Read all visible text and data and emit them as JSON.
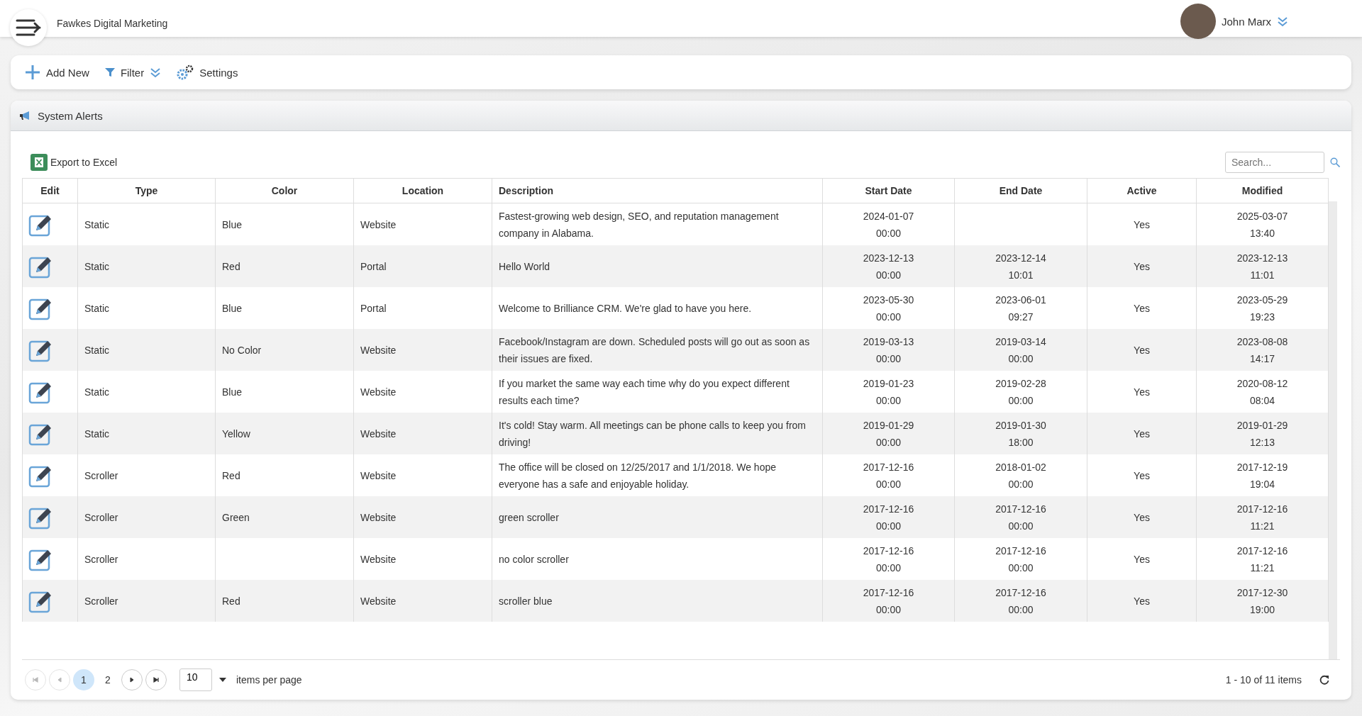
{
  "header": {
    "company": "Fawkes Digital Marketing",
    "user": "John Marx"
  },
  "toolbar": [
    {
      "kind": "add",
      "label": "Add New"
    },
    {
      "kind": "filter",
      "label": "Filter"
    },
    {
      "kind": "settings",
      "label": "Settings"
    }
  ],
  "panel": {
    "title": "System Alerts",
    "export_label": "Export to Excel",
    "search": {
      "placeholder": "Search..."
    }
  },
  "table": {
    "columns": [
      "Edit",
      "Type",
      "Color",
      "Location",
      "Description",
      "Start Date",
      "End Date",
      "Active",
      "Modified"
    ],
    "rows": [
      {
        "type": "Static",
        "color_name": "Blue",
        "location": "Website",
        "description": "Fastest-growing web design, SEO, and reputation management company in Alabama.",
        "start": [
          "2024-01-07",
          "00:00"
        ],
        "end": [],
        "active": "Yes",
        "modified": [
          "2025-03-07",
          "13:40"
        ]
      },
      {
        "type": "Static",
        "color_name": "Red",
        "location": "Portal",
        "description": "Hello World",
        "start": [
          "2023-12-13",
          "00:00"
        ],
        "end": [
          "2023-12-14",
          "10:01"
        ],
        "active": "Yes",
        "modified": [
          "2023-12-13",
          "11:01"
        ]
      },
      {
        "type": "Static",
        "color_name": "Blue",
        "location": "Portal",
        "description": "Welcome to Brilliance CRM. We're glad to have you here.",
        "start": [
          "2023-05-30",
          "00:00"
        ],
        "end": [
          "2023-06-01",
          "09:27"
        ],
        "active": "Yes",
        "modified": [
          "2023-05-29",
          "19:23"
        ]
      },
      {
        "type": "Static",
        "color_name": "No Color",
        "location": "Website",
        "description": "Facebook/Instagram are down. Scheduled posts will go out as soon as their issues are fixed.",
        "start": [
          "2019-03-13",
          "00:00"
        ],
        "end": [
          "2019-03-14",
          "00:00"
        ],
        "active": "Yes",
        "modified": [
          "2023-08-08",
          "14:17"
        ]
      },
      {
        "type": "Static",
        "color_name": "Blue",
        "location": "Website",
        "description": "If you market the same way each time why do you expect different results each time?",
        "start": [
          "2019-01-23",
          "00:00"
        ],
        "end": [
          "2019-02-28",
          "00:00"
        ],
        "active": "Yes",
        "modified": [
          "2020-08-12",
          "08:04"
        ]
      },
      {
        "type": "Static",
        "color_name": "Yellow",
        "location": "Website",
        "description": "It's cold! Stay warm. All meetings can be phone calls to keep you from driving!",
        "start": [
          "2019-01-29",
          "00:00"
        ],
        "end": [
          "2019-01-30",
          "18:00"
        ],
        "active": "Yes",
        "modified": [
          "2019-01-29",
          "12:13"
        ]
      },
      {
        "type": "Scroller",
        "color_name": "Red",
        "location": "Website",
        "description": "The office will be closed on 12/25/2017 and 1/1/2018. We hope everyone has a safe and enjoyable holiday.",
        "start": [
          "2017-12-16",
          "00:00"
        ],
        "end": [
          "2018-01-02",
          "00:00"
        ],
        "active": "Yes",
        "modified": [
          "2017-12-19",
          "19:04"
        ]
      },
      {
        "type": "Scroller",
        "color_name": "Green",
        "location": "Website",
        "description": "green scroller",
        "start": [
          "2017-12-16",
          "00:00"
        ],
        "end": [
          "2017-12-16",
          "00:00"
        ],
        "active": "Yes",
        "modified": [
          "2017-12-16",
          "11:21"
        ]
      },
      {
        "type": "Scroller",
        "location": "Website",
        "description": "no color scroller",
        "start": [
          "2017-12-16",
          "00:00"
        ],
        "end": [
          "2017-12-16",
          "00:00"
        ],
        "active": "Yes",
        "modified": [
          "2017-12-16",
          "11:21"
        ]
      },
      {
        "type": "Scroller",
        "color_name": "Red",
        "location": "Website",
        "description": "scroller blue",
        "start": [
          "2017-12-16",
          "00:00"
        ],
        "end": [
          "2017-12-16",
          "00:00"
        ],
        "active": "Yes",
        "modified": [
          "2017-12-30",
          "19:00"
        ]
      }
    ]
  },
  "pager": {
    "nav_start": [
      {
        "kind": "first",
        "disabled": true
      },
      {
        "kind": "prev",
        "disabled": true
      }
    ],
    "pages": [
      {
        "label": "1",
        "selected": true
      },
      {
        "label": "2",
        "selected": false
      }
    ],
    "nav_end": [
      {
        "kind": "next",
        "disabled": false
      },
      {
        "kind": "last",
        "disabled": false
      }
    ],
    "page_size": "10",
    "page_size_label": "items per page",
    "summary": "1 - 10 of 11 items"
  }
}
